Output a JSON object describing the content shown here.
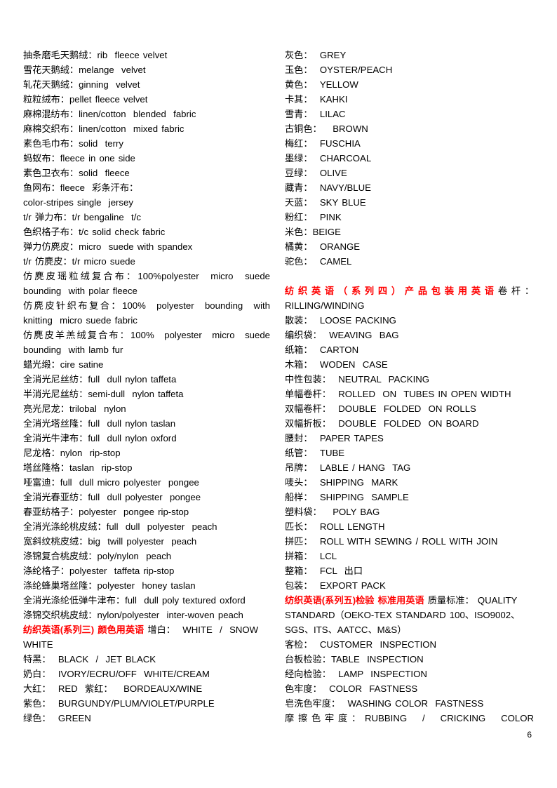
{
  "page": {
    "number": "6",
    "accent_red": "#FF0000",
    "text_color": "#000000",
    "background": "#FFFFFF"
  },
  "left_column": {
    "lines": [
      {
        "type": "entry",
        "term": "抽条磨毛天鹅绒：",
        "english": "rib  fleece velvet"
      },
      {
        "type": "entry",
        "term": "雪花天鹅绒：",
        "english": "melange  velvet"
      },
      {
        "type": "entry",
        "term": "轧花天鹅绒：",
        "english": "ginning  velvet"
      },
      {
        "type": "entry",
        "term": "粒粒绒布：",
        "english": "pellet fleece velvet"
      },
      {
        "type": "entry",
        "term": "麻棉混纺布：",
        "english": "linen/cotton  blended  fabric"
      },
      {
        "type": "entry",
        "term": "麻棉交织布：",
        "english": "linen/cotton  mixed fabric"
      },
      {
        "type": "entry",
        "term": "素色毛巾布：",
        "english": "solid  terry"
      },
      {
        "type": "entry",
        "term": "蚂蚁布：",
        "english": "fleece in one side"
      },
      {
        "type": "entry",
        "term": "素色卫衣布：",
        "english": "solid  fleece"
      },
      {
        "type": "entry",
        "term": "鱼网布：",
        "english": "fleece  彩条汗布："
      },
      {
        "type": "cont",
        "term": "",
        "english": "color-stripes single  jersey"
      },
      {
        "type": "entry",
        "term": "t/r 弹力布：",
        "english": "t/r bengaline  t/c"
      },
      {
        "type": "entry",
        "term": "色织格子布：",
        "english": "t/c solid check fabric"
      },
      {
        "type": "entry",
        "term": "弹力仿麂皮：",
        "english": "micro  suede with spandex"
      },
      {
        "type": "entry",
        "term": "t/r 仿麂皮：",
        "english": "t/r micro suede"
      },
      {
        "type": "entry-justify",
        "term": "仿麂皮瑶粒绒复合布：",
        "english": "100%polyester  micro  suede"
      },
      {
        "type": "cont",
        "term": "",
        "english": "bounding  with polar fleece"
      },
      {
        "type": "entry-justify",
        "term": "仿麂皮针织布复合：",
        "english": "100%  polyester  bounding  with"
      },
      {
        "type": "cont",
        "term": "",
        "english": "knitting  micro suede fabric"
      },
      {
        "type": "entry-justify",
        "term": "仿麂皮羊羔绒复合布：",
        "english": "100%  polyester  micro  suede"
      },
      {
        "type": "cont",
        "term": "",
        "english": "bounding  with lamb fur"
      },
      {
        "type": "entry",
        "term": "蜡光缎：",
        "english": "cire satine"
      },
      {
        "type": "entry",
        "term": "全消光尼丝纺：",
        "english": "full  dull nylon taffeta"
      },
      {
        "type": "entry",
        "term": "半消光尼丝纺：",
        "english": "semi-dull  nylon taffeta"
      },
      {
        "type": "entry",
        "term": "亮光尼龙：",
        "english": "trilobal  nylon"
      },
      {
        "type": "entry",
        "term": "全消光塔丝隆：",
        "english": "full  dull nylon taslan"
      },
      {
        "type": "entry",
        "term": "全消光牛津布：",
        "english": "full  dull nylon oxford"
      },
      {
        "type": "entry",
        "term": "尼龙格：",
        "english": "nylon  rip-stop"
      },
      {
        "type": "entry",
        "term": "塔丝隆格：",
        "english": "taslan  rip-stop"
      },
      {
        "type": "entry",
        "term": "哑富迪：",
        "english": "full  dull micro polyester  pongee"
      },
      {
        "type": "entry",
        "term": "全消光春亚纺：",
        "english": "full  dull polyester  pongee"
      },
      {
        "type": "entry",
        "term": "春亚纺格子：",
        "english": "polyester  pongee rip-stop"
      },
      {
        "type": "entry",
        "term": "全消光涤纶桃皮绒：",
        "english": "full  dull  polyester  peach"
      },
      {
        "type": "entry",
        "term": "宽斜纹桃皮绒：",
        "english": "big  twill polyester  peach"
      },
      {
        "type": "entry",
        "term": "涤锦复合桃皮绒：",
        "english": "poly/nylon  peach"
      },
      {
        "type": "entry",
        "term": "涤纶格子：",
        "english": "polyester  taffeta rip-stop"
      },
      {
        "type": "entry",
        "term": "涤纶蜂巢塔丝隆：",
        "english": "polyester  honey taslan"
      },
      {
        "type": "entry",
        "term": "全消光涤纶低弹牛津布：",
        "english": "full  dull poly textured oxford"
      },
      {
        "type": "entry",
        "term": "涤锦交织桃皮绒：",
        "english": "nylon/polyester  inter-woven peach"
      },
      {
        "type": "heading-inline",
        "heading": "纺织英语(系列三) 颜色用英语",
        "term": " 增白：",
        "english": "  WHITE  /  SNOW"
      },
      {
        "type": "cont",
        "term": "",
        "english": "WHITE"
      },
      {
        "type": "entry",
        "term": "特黑：",
        "english": "  BLACK  /  JET BLACK"
      },
      {
        "type": "entry",
        "term": "奶白：",
        "english": "  IVORY/ECRU/OFF  WHITE/CREAM"
      },
      {
        "type": "entry",
        "term": "大红：",
        "english": "  RED  紫红：   BORDEAUX/WINE"
      },
      {
        "type": "entry",
        "term": "紫色：",
        "english": "  BURGUNDY/PLUM/VIOLET/PURPLE"
      },
      {
        "type": "entry",
        "term": "绿色：",
        "english": "  GREEN"
      }
    ]
  },
  "right_column": {
    "lines": [
      {
        "type": "entry",
        "term": "灰色：",
        "english": "  GREY"
      },
      {
        "type": "entry",
        "term": "玉色：",
        "english": "  OYSTER/PEACH"
      },
      {
        "type": "entry",
        "term": "黄色：",
        "english": "  YELLOW"
      },
      {
        "type": "entry",
        "term": "卡其：",
        "english": "  KAHKI"
      },
      {
        "type": "entry",
        "term": "雪青：",
        "english": "  LILAC"
      },
      {
        "type": "entry",
        "term": "古铜色：",
        "english": "   BROWN"
      },
      {
        "type": "entry",
        "term": "梅红：",
        "english": "  FUSCHIA"
      },
      {
        "type": "entry",
        "term": "墨绿：",
        "english": "  CHARCOAL"
      },
      {
        "type": "entry",
        "term": "豆绿：",
        "english": "  OLIVE"
      },
      {
        "type": "entry",
        "term": "藏青：",
        "english": "  NAVY/BLUE"
      },
      {
        "type": "entry",
        "term": "天蓝：",
        "english": "  SKY BLUE"
      },
      {
        "type": "entry",
        "term": "粉红：",
        "english": "  PINK"
      },
      {
        "type": "entry",
        "term": "米色：",
        "english": "BEIGE"
      },
      {
        "type": "entry",
        "term": "橘黄：",
        "english": "  ORANGE"
      },
      {
        "type": "entry",
        "term": "驼色：",
        "english": "  CAMEL"
      },
      {
        "type": "blank",
        "term": "",
        "english": ""
      },
      {
        "type": "heading-inline-justify",
        "heading": "纺织英语（系列四）产品包装用英语",
        "term": "卷杆：",
        "english": ""
      },
      {
        "type": "cont",
        "term": "",
        "english": "RILLING/WINDING"
      },
      {
        "type": "entry",
        "term": "散装：",
        "english": "  LOOSE PACKING"
      },
      {
        "type": "entry",
        "term": "编织袋：",
        "english": "  WEAVING  BAG"
      },
      {
        "type": "entry",
        "term": "纸箱：",
        "english": "  CARTON"
      },
      {
        "type": "entry",
        "term": "木箱：",
        "english": "  WODEN  CASE"
      },
      {
        "type": "entry",
        "term": "中性包装：",
        "english": "  NEUTRAL  PACKING"
      },
      {
        "type": "entry",
        "term": "单幅卷杆：",
        "english": "  ROLLED  ON  TUBES IN OPEN WIDTH"
      },
      {
        "type": "entry",
        "term": "双幅卷杆：",
        "english": "  DOUBLE  FOLDED  ON ROLLS"
      },
      {
        "type": "entry",
        "term": "双幅折板：",
        "english": "  DOUBLE  FOLDED  ON BOARD"
      },
      {
        "type": "entry",
        "term": "腰封：",
        "english": "  PAPER TAPES"
      },
      {
        "type": "entry",
        "term": "纸管：",
        "english": "  TUBE"
      },
      {
        "type": "entry",
        "term": "吊牌：",
        "english": "  LABLE / HANG  TAG"
      },
      {
        "type": "entry",
        "term": "唛头：",
        "english": "  SHIPPING  MARK"
      },
      {
        "type": "entry",
        "term": "船样：",
        "english": "  SHIPPING  SAMPLE"
      },
      {
        "type": "entry",
        "term": "塑料袋：",
        "english": "   POLY BAG"
      },
      {
        "type": "entry",
        "term": "匹长：",
        "english": "  ROLL LENGTH"
      },
      {
        "type": "entry",
        "term": "拼匹：",
        "english": "  ROLL WITH SEWING / ROLL WITH JOIN"
      },
      {
        "type": "entry",
        "term": "拼箱：",
        "english": "  LCL"
      },
      {
        "type": "entry",
        "term": "整箱：",
        "english": "  FCL  出口"
      },
      {
        "type": "entry",
        "term": "包装：",
        "english": "  EXPORT PACK"
      },
      {
        "type": "heading-inline",
        "heading": "纺织英语(系列五)检验 标准用英语",
        "term": " 质量标准：",
        "english": " QUALITY"
      },
      {
        "type": "cont",
        "term": "",
        "english": "STANDARD（OEKO-TEX STANDARD 100、ISO9002、"
      },
      {
        "type": "cont",
        "term": "",
        "english": "SGS、ITS、AATCC、M&S）"
      },
      {
        "type": "entry",
        "term": "客检：",
        "english": "  CUSTOMER  INSPECTION"
      },
      {
        "type": "entry",
        "term": "台板检验：",
        "english": "TABLE  INSPECTION"
      },
      {
        "type": "entry",
        "term": "经向检验：",
        "english": "  LAMP  INSPECTION"
      },
      {
        "type": "entry",
        "term": "色牢度：",
        "english": "  COLOR  FASTNESS"
      },
      {
        "type": "entry",
        "term": "皂洗色牢度：",
        "english": "  WASHING COLOR  FASTNESS"
      },
      {
        "type": "entry-justify",
        "term": "摩擦色牢度：",
        "english": "RUBBING  /  CRICKING  COLOR"
      }
    ]
  }
}
